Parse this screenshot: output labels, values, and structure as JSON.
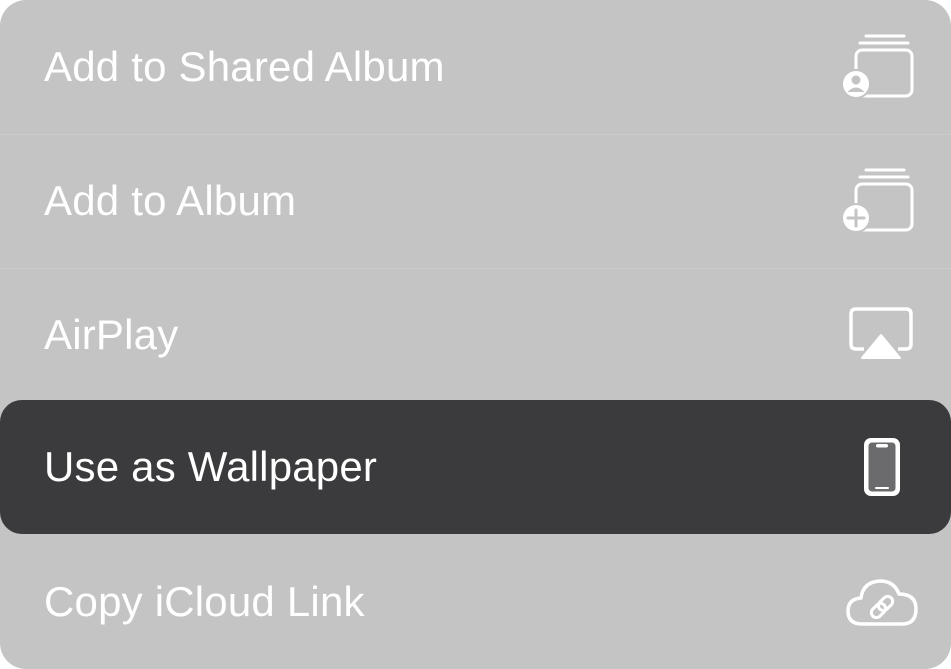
{
  "menu": {
    "items": [
      {
        "label": "Add to Shared Album",
        "icon": "shared-album-icon",
        "highlighted": false
      },
      {
        "label": "Add to Album",
        "icon": "add-album-icon",
        "highlighted": false
      },
      {
        "label": "AirPlay",
        "icon": "airplay-icon",
        "highlighted": false
      },
      {
        "label": "Use as Wallpaper",
        "icon": "iphone-icon",
        "highlighted": true
      },
      {
        "label": "Copy iCloud Link",
        "icon": "icloud-link-icon",
        "highlighted": false
      }
    ]
  },
  "colors": {
    "menu_background": "#c4c4c4",
    "highlight_background": "#3b3b3d",
    "text": "#ffffff"
  }
}
